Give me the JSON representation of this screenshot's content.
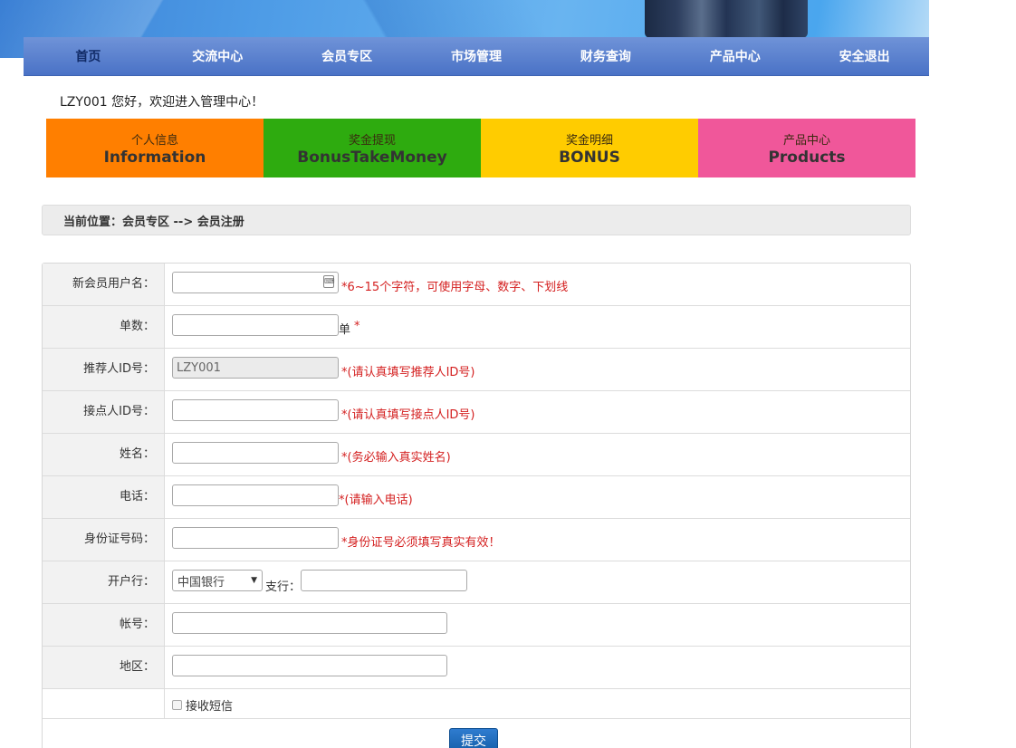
{
  "nav": {
    "items": [
      "首页",
      "交流中心",
      "会员专区",
      "市场管理",
      "财务查询",
      "产品中心",
      "安全退出"
    ]
  },
  "welcome": "LZY001 您好，欢迎进入管理中心！",
  "tiles": [
    {
      "zh": "个人信息",
      "en": "Information",
      "color": "#ff7f00"
    },
    {
      "zh": "奖金提现",
      "en": "BonusTakeMoney",
      "color": "#2eab0f"
    },
    {
      "zh": "奖金明细",
      "en": "BONUS",
      "color": "#ffcc00"
    },
    {
      "zh": "产品中心",
      "en": "Products",
      "color": "#f0579a"
    }
  ],
  "breadcrumb": "当前位置：会员专区 --> 会员注册",
  "form": {
    "username": {
      "label": "新会员用户名：",
      "value": "",
      "hint": "*6~15个字符，可使用字母、数字、下划线"
    },
    "orders": {
      "label": "单数：",
      "value": "",
      "unit": "单",
      "star": "*"
    },
    "referrer": {
      "label": "推荐人ID号：",
      "value": "LZY001",
      "hint": "*(请认真填写推荐人ID号)"
    },
    "contact": {
      "label": "接点人ID号：",
      "value": "",
      "hint": "*(请认真填写接点人ID号)"
    },
    "name": {
      "label": "姓名：",
      "value": "",
      "hint": "*(务必输入真实姓名)"
    },
    "phone": {
      "label": "电话：",
      "value": "",
      "hint": "*(请输入电话)"
    },
    "idcard": {
      "label": "身份证号码：",
      "value": "",
      "hint": "*身份证号必须填写真实有效！"
    },
    "bank": {
      "label": "开户行：",
      "selected": "中国银行",
      "branch_label": "支行：",
      "branch_value": ""
    },
    "account": {
      "label": "帐号：",
      "value": ""
    },
    "region": {
      "label": "地区：",
      "value": ""
    },
    "sms": {
      "label": "接收短信",
      "checked": false
    },
    "submit": "提交"
  },
  "icons": {
    "keyboard": "keyboard-icon",
    "dropdown": "chevron-down-icon"
  }
}
